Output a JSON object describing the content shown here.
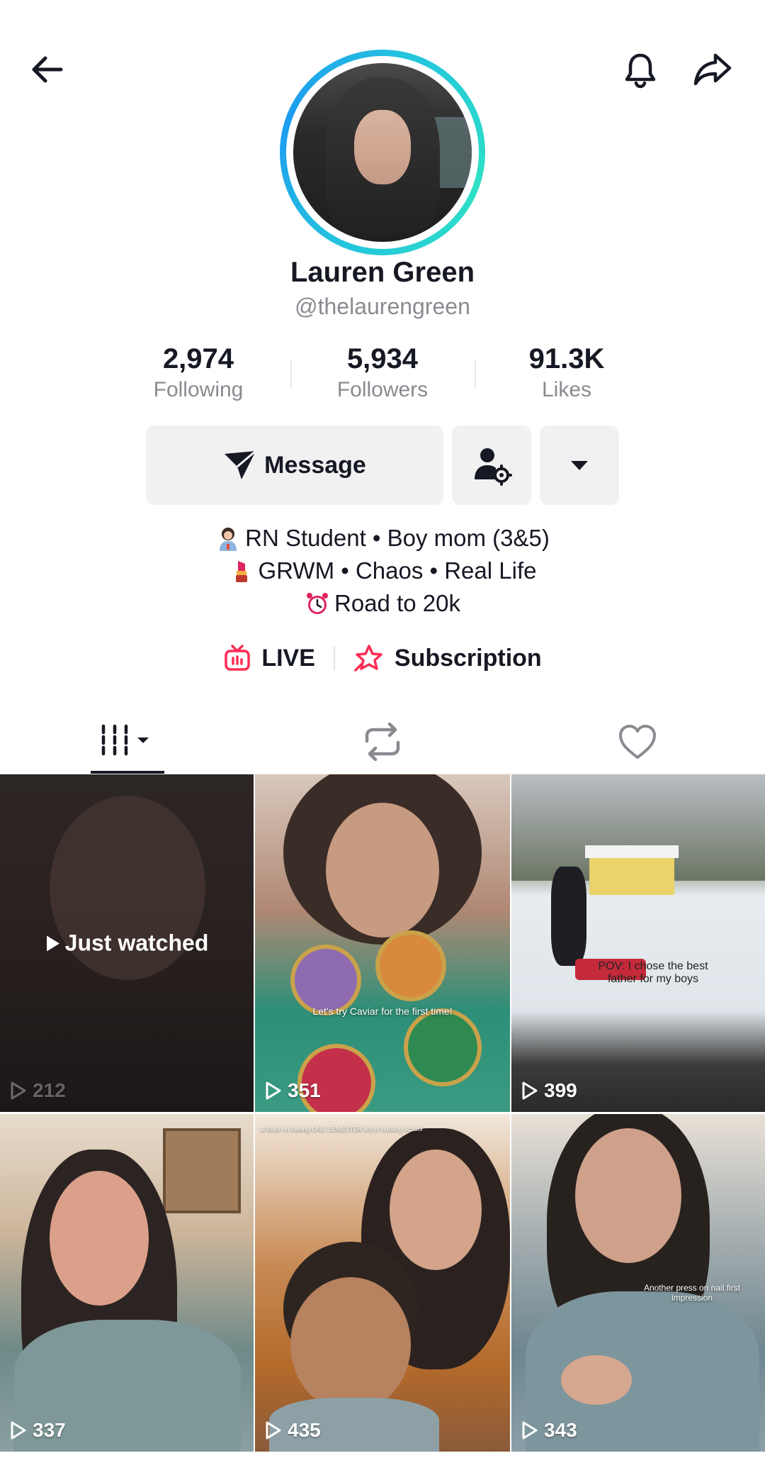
{
  "profile": {
    "display_name": "Lauren Green",
    "username": "@thelaurengreen"
  },
  "stats": [
    {
      "value": "2,974",
      "label": "Following"
    },
    {
      "value": "5,934",
      "label": "Followers"
    },
    {
      "value": "91.3K",
      "label": "Likes"
    }
  ],
  "actions": {
    "message_label": "Message"
  },
  "bio": {
    "line1": "RN Student • Boy mom (3&5)",
    "line2": "GRWM • Chaos • Real Life",
    "line3": "Road to 20k"
  },
  "links": {
    "live": "LIVE",
    "subscription": "Subscription"
  },
  "videos": [
    {
      "views": "212",
      "label": "Just watched"
    },
    {
      "views": "351",
      "caption": "Let's try Caviar for the first time!"
    },
    {
      "views": "399",
      "caption": "POV: I chose the best father for my boys"
    },
    {
      "views": "337"
    },
    {
      "views": "435",
      "caption": "& thats on having ONE SEMESTER left of nursing school"
    },
    {
      "views": "343",
      "caption": "Another press on nail first impression"
    }
  ],
  "colors": {
    "accent_live": "#fe2c55",
    "text_primary": "#161823",
    "text_secondary": "#8a8b91",
    "avatar_ring": "#24c6dc"
  },
  "icons": {
    "back": "arrow-left-icon",
    "bell": "bell-icon",
    "share": "share-arrow-icon",
    "message": "paper-plane-icon",
    "add_friend": "person-gear-icon",
    "dropdown": "caret-down-icon",
    "live": "tv-icon",
    "subscription": "star-icon",
    "tab_videos": "grid-icon",
    "tab_reposts": "repost-icon",
    "tab_liked": "heart-icon",
    "play": "play-icon"
  }
}
